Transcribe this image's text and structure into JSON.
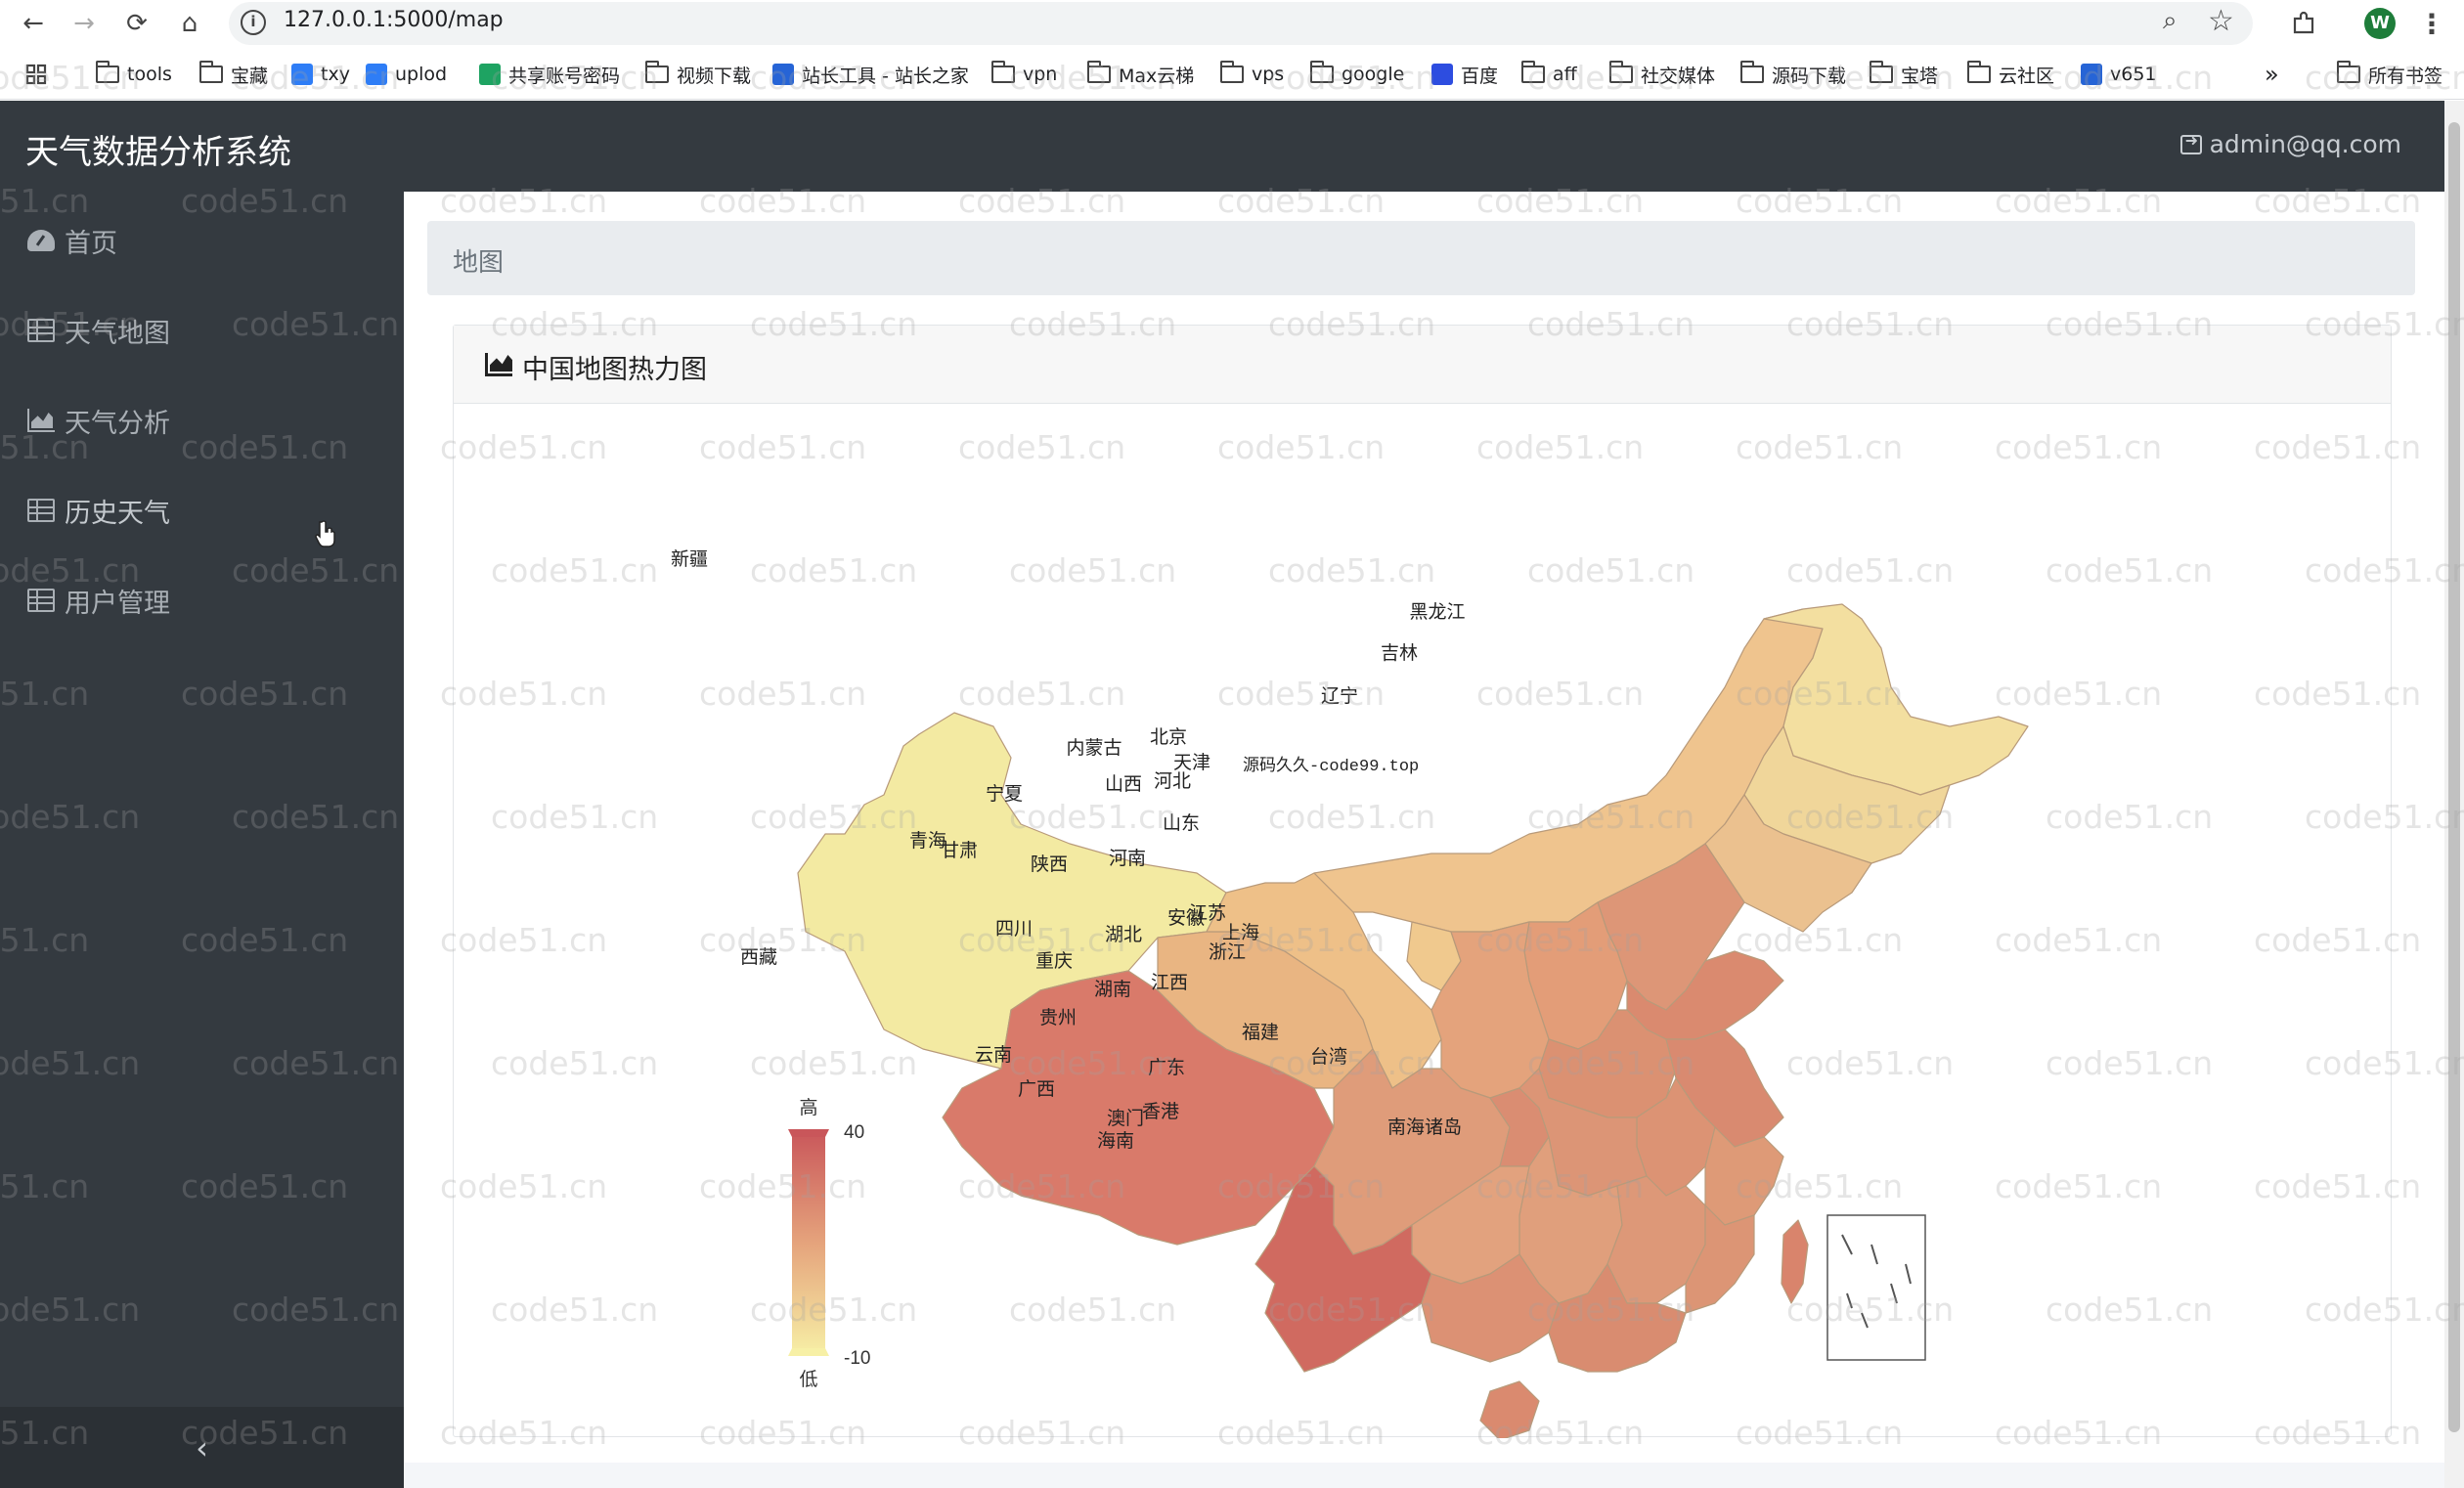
{
  "browser": {
    "url": "127.0.0.1:5000/map",
    "bookmarks": [
      {
        "label": "tools",
        "type": "folder"
      },
      {
        "label": "宝藏",
        "type": "folder"
      },
      {
        "label": "txy",
        "type": "cloud"
      },
      {
        "label": "uplod",
        "type": "cloud"
      },
      {
        "label": "共享账号密码",
        "type": "sheet"
      },
      {
        "label": "视频下载",
        "type": "folder"
      },
      {
        "label": "站长工具 - 站长之家",
        "type": "site"
      },
      {
        "label": "vpn",
        "type": "folder"
      },
      {
        "label": "Max云梯",
        "type": "folder"
      },
      {
        "label": "vps",
        "type": "folder"
      },
      {
        "label": "google",
        "type": "folder"
      },
      {
        "label": "百度",
        "type": "baidu"
      },
      {
        "label": "aff",
        "type": "folder"
      },
      {
        "label": "社交媒体",
        "type": "folder"
      },
      {
        "label": "源码下载",
        "type": "folder"
      },
      {
        "label": "宝塔",
        "type": "folder"
      },
      {
        "label": "云社区",
        "type": "folder"
      },
      {
        "label": "v651",
        "type": "site"
      }
    ],
    "more_label": "»",
    "all_bookmarks": "所有书签",
    "profile_initial": "W"
  },
  "app": {
    "brand": "天气数据分析系统",
    "user_email": "admin@qq.com",
    "sidebar": [
      {
        "label": "首页",
        "icon": "dashboard-icon"
      },
      {
        "label": "天气地图",
        "icon": "table-icon"
      },
      {
        "label": "天气分析",
        "icon": "area-chart-icon"
      },
      {
        "label": "历史天气",
        "icon": "table-icon"
      },
      {
        "label": "用户管理",
        "icon": "table-icon"
      }
    ],
    "collapse_label": "‹"
  },
  "page": {
    "breadcrumb": "地图",
    "card_title": "中国地图热力图"
  },
  "map": {
    "overlay_text": "源码久久-code99.top",
    "visual_map": {
      "high_label": "高",
      "low_label": "低",
      "max": "40",
      "min": "-10",
      "color_high": "#c9565a",
      "color_low": "#f7f0a6"
    },
    "provinces": [
      {
        "name": "新疆"
      },
      {
        "name": "西藏"
      },
      {
        "name": "青海"
      },
      {
        "name": "甘肃"
      },
      {
        "name": "宁夏"
      },
      {
        "name": "内蒙古"
      },
      {
        "name": "黑龙江"
      },
      {
        "name": "吉林"
      },
      {
        "name": "辽宁"
      },
      {
        "name": "北京"
      },
      {
        "name": "天津"
      },
      {
        "name": "河北"
      },
      {
        "name": "山西"
      },
      {
        "name": "山东"
      },
      {
        "name": "陕西"
      },
      {
        "name": "河南"
      },
      {
        "name": "江苏"
      },
      {
        "name": "安徽"
      },
      {
        "name": "上海"
      },
      {
        "name": "浙江"
      },
      {
        "name": "四川"
      },
      {
        "name": "重庆"
      },
      {
        "name": "湖北"
      },
      {
        "name": "湖南"
      },
      {
        "name": "江西"
      },
      {
        "name": "贵州"
      },
      {
        "name": "云南"
      },
      {
        "name": "福建"
      },
      {
        "name": "台湾"
      },
      {
        "name": "广西"
      },
      {
        "name": "广东"
      },
      {
        "name": "澳门"
      },
      {
        "name": "香港"
      },
      {
        "name": "海南"
      },
      {
        "name": "南海诸岛"
      }
    ]
  },
  "watermark": "code51.cn"
}
